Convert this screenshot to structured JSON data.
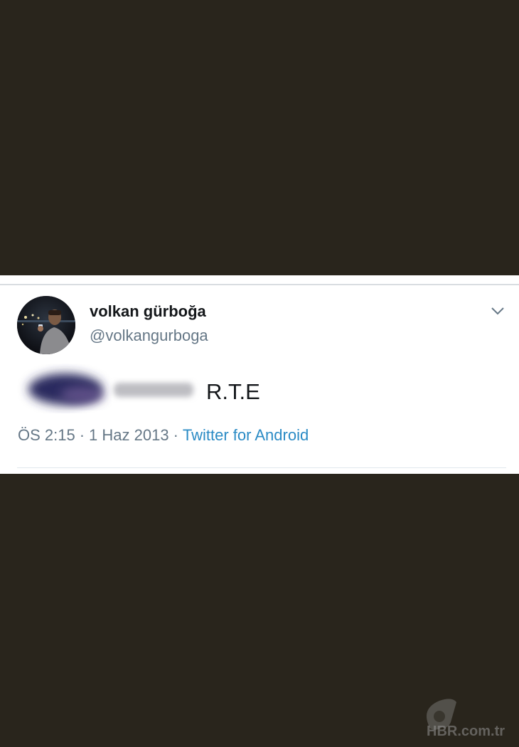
{
  "tweet": {
    "display_name": "volkan gürboğa",
    "handle": "@volkangurboga",
    "text": "R.T.E",
    "time": "ÖS 2:15",
    "separator": "·",
    "date": "1 Haz 2013",
    "source": "Twitter for Android",
    "menu_icon": "chevron-down-icon"
  },
  "watermark": {
    "logo_letter": "a",
    "brand": "HBR",
    "domain": ".com.tr"
  },
  "colors": {
    "background": "#29251c",
    "card": "#ffffff",
    "link": "#2b8bc5",
    "secondary_text": "#657786"
  }
}
